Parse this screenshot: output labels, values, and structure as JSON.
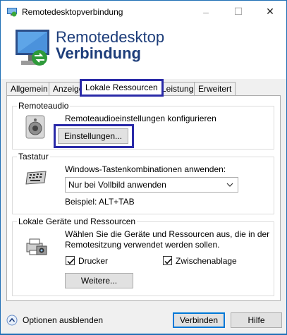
{
  "window": {
    "title": "Remotedesktopverbindung",
    "controls": {
      "minimize": "–",
      "maximize": "☐",
      "close": "✕"
    }
  },
  "banner": {
    "line1": "Remotedesktop",
    "line2": "Verbindung"
  },
  "tabs": [
    {
      "label": "Allgemein"
    },
    {
      "label": "Anzeige"
    },
    {
      "label": "Lokale Ressourcen",
      "active": true
    },
    {
      "label": "Leistung"
    },
    {
      "label": "Erweitert"
    }
  ],
  "remoteaudio": {
    "legend": "Remoteaudio",
    "description": "Remoteaudioeinstellungen konfigurieren",
    "settings_button": "Einstellungen..."
  },
  "keyboard": {
    "legend": "Tastatur",
    "label": "Windows-Tastenkombinationen anwenden:",
    "selected": "Nur bei Vollbild anwenden",
    "example": "Beispiel: ALT+TAB"
  },
  "local_devices": {
    "legend": "Lokale Geräte und Ressourcen",
    "description_line1": "Wählen Sie die Geräte und Ressourcen aus, die in der",
    "description_line2": "Remotesitzung verwendet werden sollen.",
    "printer": {
      "label": "Drucker",
      "checked": true
    },
    "clipboard": {
      "label": "Zwischenablage",
      "checked": true
    },
    "more_button": "Weitere..."
  },
  "footer": {
    "options_toggle": "Optionen ausblenden",
    "connect_button": "Verbinden",
    "help_button": "Hilfe"
  }
}
